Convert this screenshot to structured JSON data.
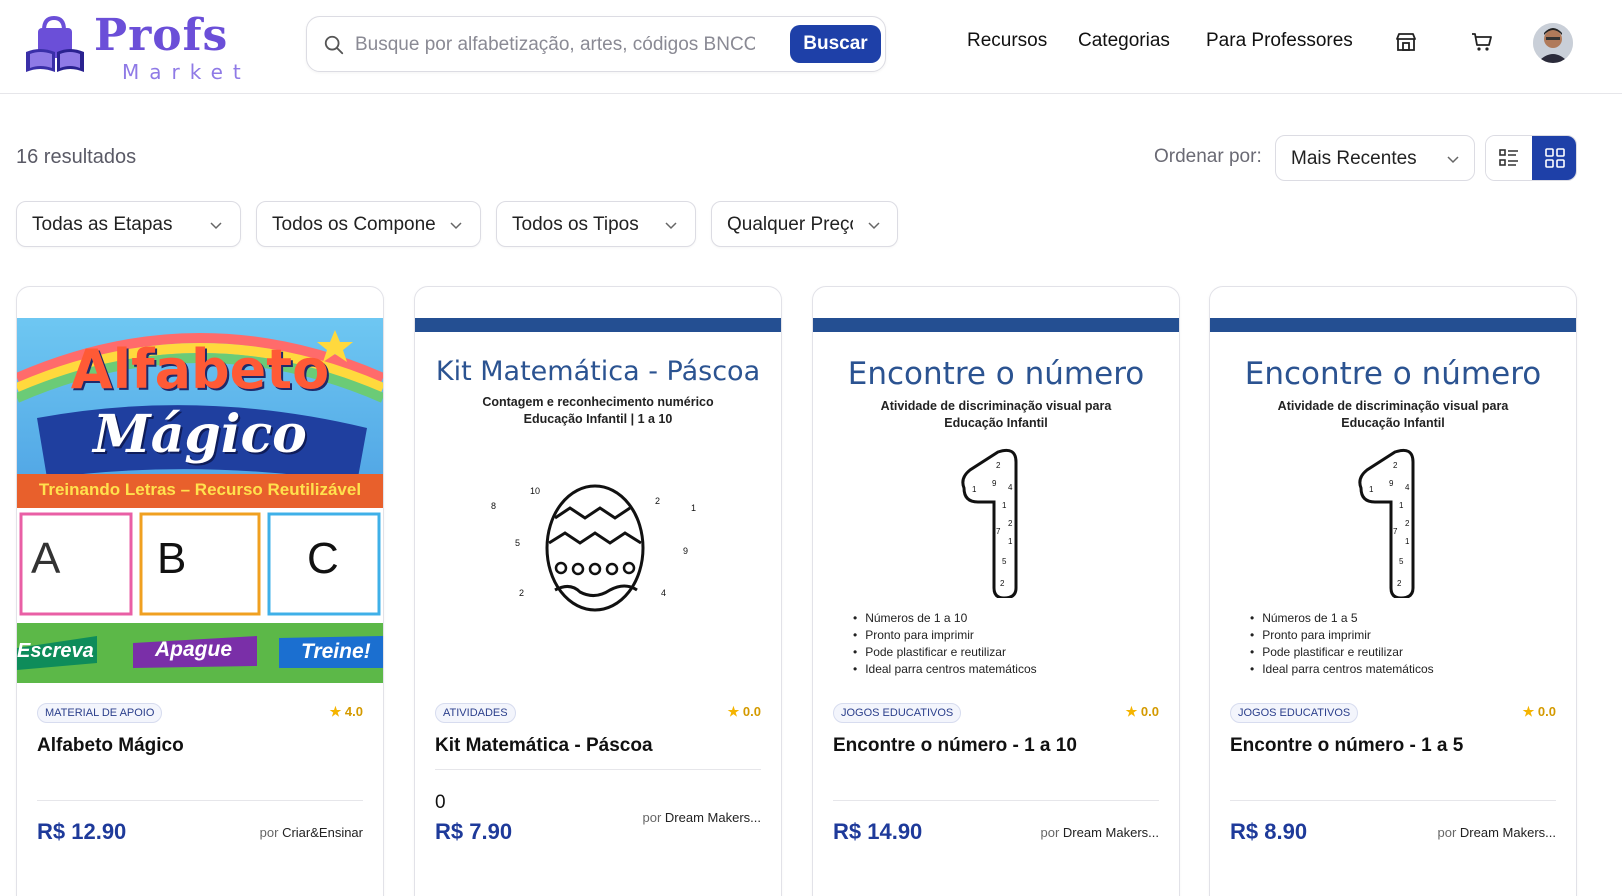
{
  "brand": {
    "name_main": "Profs",
    "name_sub": "Market"
  },
  "search": {
    "placeholder": "Busque por alfabetização, artes, códigos BNCC...",
    "button_label": "Buscar"
  },
  "nav": {
    "items": [
      "Recursos",
      "Categorias",
      "Para Professores"
    ]
  },
  "header_icons": [
    "store-icon",
    "cart-icon",
    "avatar"
  ],
  "results": {
    "count_label": "16 resultados",
    "order_label": "Ordenar por:",
    "order_value": "Mais Recentes",
    "view_mode": "grid"
  },
  "filters": [
    "Todas as Etapas",
    "Todos os Componentes",
    "Todos os Tipos",
    "Qualquer Preço"
  ],
  "colors": {
    "primary": "#1e40a8",
    "accent_purple": "#6b4fd8",
    "thumb_bar": "#244f92",
    "star": "#f5b400"
  },
  "products": [
    {
      "thumb": {
        "title_line1": "Alfabeto",
        "title_line2": "Mágico",
        "banner": "Treinando Letras – Recurso Reutilizável",
        "letters": [
          "A",
          "B",
          "C"
        ],
        "buttons": [
          "Escreva",
          "Apague",
          "Treine!"
        ]
      },
      "category": "Material de Apoio",
      "rating": "4.0",
      "title": "Alfabeto Mágico",
      "price": "R$ 12.90",
      "author_prefix": "por",
      "author": "Criar&Ensinar",
      "extra": ""
    },
    {
      "thumb": {
        "title": "Kit Matemática - Páscoa",
        "subtitle_line1": "Contagem e reconhecimento numérico",
        "subtitle_line2": "Educação Infantil | 1 a 10",
        "dots": [
          "10",
          "8",
          "2",
          "1",
          "5",
          "9",
          "2",
          "4"
        ]
      },
      "category": "Atividades",
      "rating": "0.0",
      "title": "Kit Matemática - Páscoa",
      "price": "R$ 7.90",
      "author_prefix": "por",
      "author": "Dream Makers...",
      "extra": "0"
    },
    {
      "thumb": {
        "title": "Encontre o número",
        "subtitle_line1": "Atividade de  discriminação visual para",
        "subtitle_line2": "Educação Infantil",
        "bullets": [
          "Números de 1 a 10",
          "Pronto para imprimir",
          "Pode plastificar e reutilizar",
          "Ideal parra centros matemáticos"
        ]
      },
      "category": "Jogos Educativos",
      "rating": "0.0",
      "title": "Encontre o número - 1 a 10",
      "price": "R$ 14.90",
      "author_prefix": "por",
      "author": "Dream Makers...",
      "extra": ""
    },
    {
      "thumb": {
        "title": "Encontre o número",
        "subtitle_line1": "Atividade de  discriminação visual para",
        "subtitle_line2": "Educação Infantil",
        "bullets": [
          "Números de 1 a 5",
          "Pronto para imprimir",
          "Pode plastificar e reutilizar",
          "Ideal parra centros matemáticos"
        ]
      },
      "category": "Jogos Educativos",
      "rating": "0.0",
      "title": "Encontre o número - 1 a 5",
      "price": "R$ 8.90",
      "author_prefix": "por",
      "author": "Dream Makers...",
      "extra": ""
    }
  ]
}
